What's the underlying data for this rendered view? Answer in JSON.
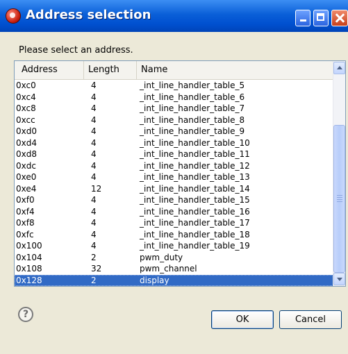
{
  "window": {
    "title": "Address selection",
    "icon": "eclipse-app-icon",
    "controls": [
      "minimize-icon",
      "maximize-icon",
      "close-icon"
    ]
  },
  "message": "Please select an address.",
  "table": {
    "columns": [
      "Address",
      "Length",
      "Name"
    ],
    "rows": [
      {
        "address": "0xc0",
        "length": "4",
        "name": "_int_line_handler_table_5"
      },
      {
        "address": "0xc4",
        "length": "4",
        "name": "_int_line_handler_table_6"
      },
      {
        "address": "0xc8",
        "length": "4",
        "name": "_int_line_handler_table_7"
      },
      {
        "address": "0xcc",
        "length": "4",
        "name": "_int_line_handler_table_8"
      },
      {
        "address": "0xd0",
        "length": "4",
        "name": "_int_line_handler_table_9"
      },
      {
        "address": "0xd4",
        "length": "4",
        "name": "_int_line_handler_table_10"
      },
      {
        "address": "0xd8",
        "length": "4",
        "name": "_int_line_handler_table_11"
      },
      {
        "address": "0xdc",
        "length": "4",
        "name": "_int_line_handler_table_12"
      },
      {
        "address": "0xe0",
        "length": "4",
        "name": "_int_line_handler_table_13"
      },
      {
        "address": "0xe4",
        "length": "12",
        "name": "_int_line_handler_table_14"
      },
      {
        "address": "0xf0",
        "length": "4",
        "name": "_int_line_handler_table_15"
      },
      {
        "address": "0xf4",
        "length": "4",
        "name": "_int_line_handler_table_16"
      },
      {
        "address": "0xf8",
        "length": "4",
        "name": "_int_line_handler_table_17"
      },
      {
        "address": "0xfc",
        "length": "4",
        "name": "_int_line_handler_table_18"
      },
      {
        "address": "0x100",
        "length": "4",
        "name": "_int_line_handler_table_19"
      },
      {
        "address": "0x104",
        "length": "2",
        "name": "pwm_duty"
      },
      {
        "address": "0x108",
        "length": "32",
        "name": "pwm_channel"
      },
      {
        "address": "0x128",
        "length": "2",
        "name": "display"
      }
    ],
    "selected_index": 17
  },
  "buttons": {
    "ok": "OK",
    "cancel": "Cancel",
    "help_icon_glyph": "?"
  },
  "colors": {
    "titlebar": "#0a5fd8",
    "selection": "#316ac5",
    "dialog_bg": "#ece9d8"
  }
}
